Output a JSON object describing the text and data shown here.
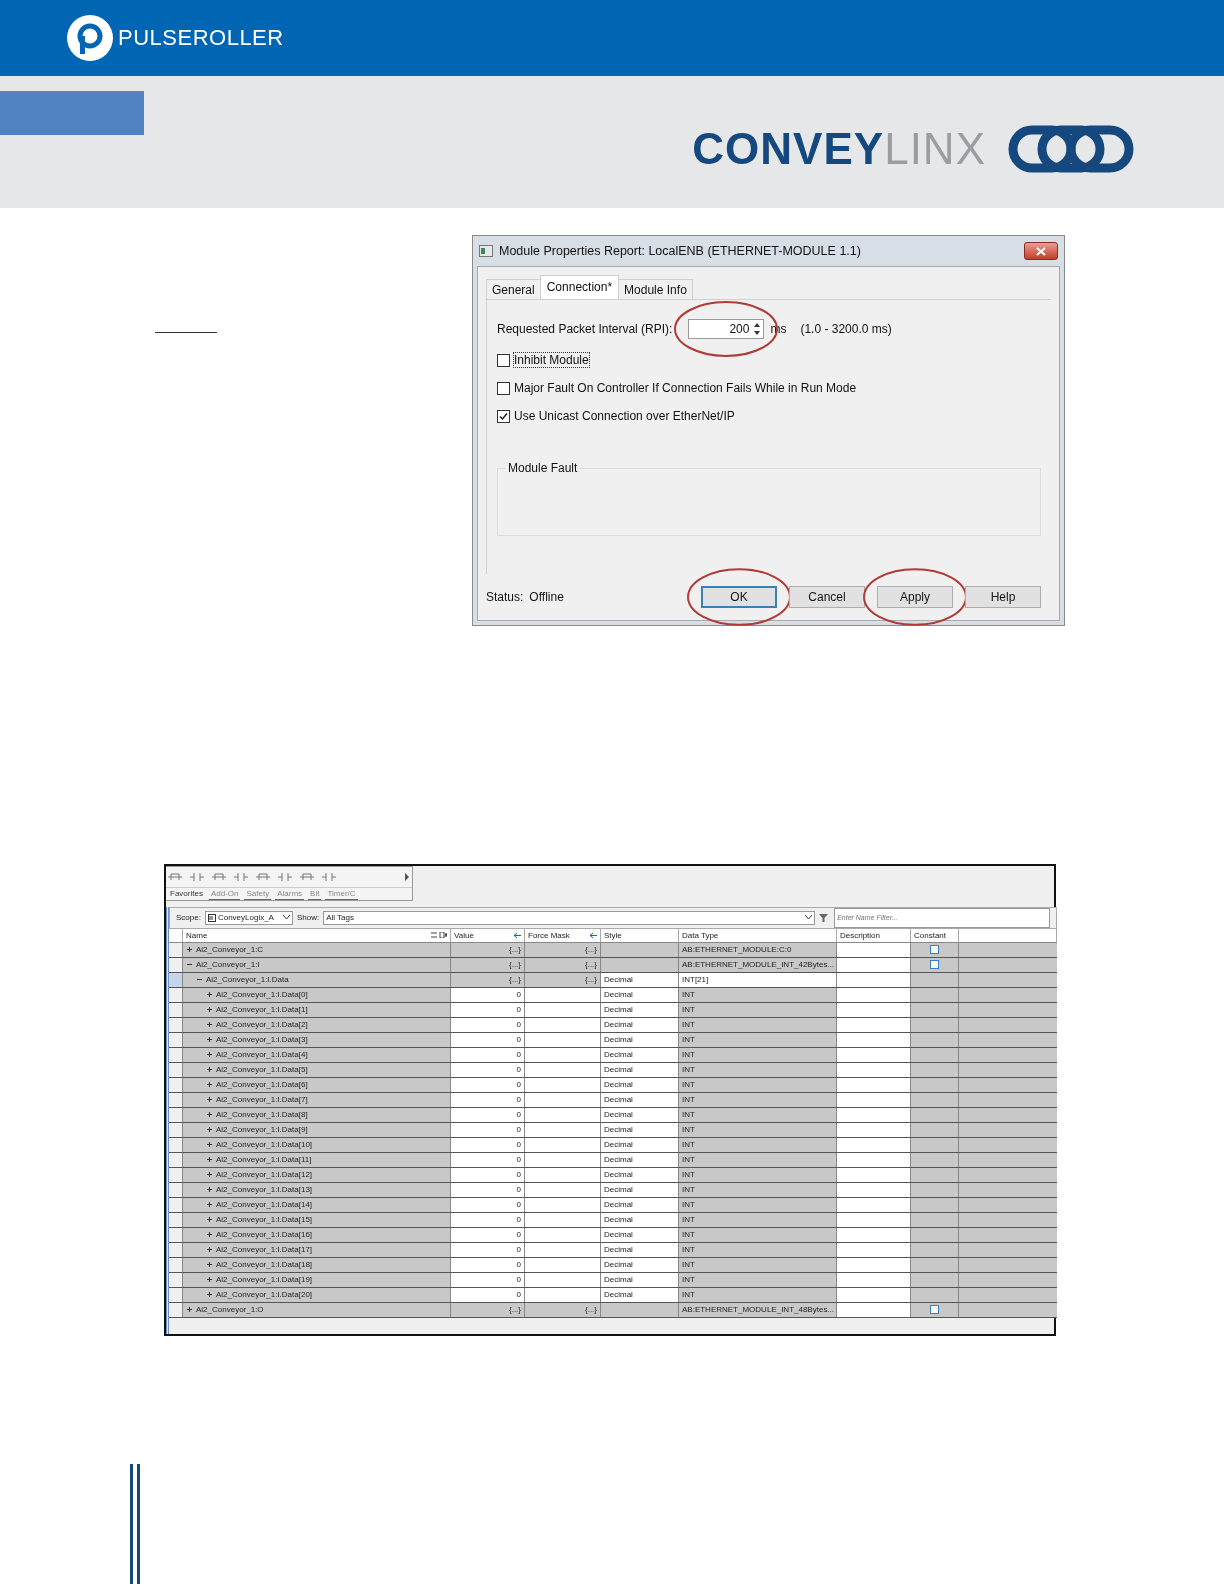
{
  "header": {
    "brand": "PULSEROLLER",
    "product_bold": "CONVEY",
    "product_light": "LINX"
  },
  "dialog": {
    "title": "Module Properties Report: LocalENB (ETHERNET-MODULE 1.1)",
    "tabs": [
      {
        "label": "General",
        "selected": false
      },
      {
        "label": "Connection*",
        "selected": true
      },
      {
        "label": "Module Info",
        "selected": false
      }
    ],
    "rpi": {
      "label": "Requested Packet Interval (RPI):",
      "value": "200",
      "unit": "ms",
      "range": "(1.0 - 3200.0 ms)",
      "circled": true
    },
    "options": [
      {
        "label": "Inhibit Module",
        "checked": false,
        "focused": true
      },
      {
        "label": "Major Fault On Controller If Connection Fails While in Run Mode",
        "checked": false,
        "focused": false
      },
      {
        "label": "Use Unicast Connection over EtherNet/IP",
        "checked": true,
        "focused": false
      }
    ],
    "group": {
      "title": "Module Fault"
    },
    "status": {
      "label": "Status:",
      "value": "Offline"
    },
    "buttons": [
      {
        "label": "OK",
        "default": true,
        "circled": true
      },
      {
        "label": "Cancel",
        "default": false,
        "circled": false
      },
      {
        "label": "Apply",
        "default": false,
        "circled": true
      },
      {
        "label": "Help",
        "default": false,
        "circled": false
      }
    ]
  },
  "tag_editor": {
    "palette_tabs": [
      {
        "label": "Favorites",
        "selected": true
      },
      {
        "label": "Add-On",
        "selected": false
      },
      {
        "label": "Safety",
        "selected": false
      },
      {
        "label": "Alarms",
        "selected": false
      },
      {
        "label": "Bit",
        "selected": false
      },
      {
        "label": "Timer/C",
        "selected": false
      }
    ],
    "scope": {
      "label": "Scope:",
      "value": "ConveyLogix_A"
    },
    "show": {
      "label": "Show:",
      "value": "All Tags"
    },
    "filter": {
      "placeholder": "Enter Name Filter..."
    },
    "columns": [
      "Name",
      "Value",
      "Force Mask",
      "Style",
      "Data Type",
      "Description",
      "Constant"
    ],
    "rows": [
      {
        "name": "Ai2_Conveyor_1:C",
        "kind": "structure",
        "expanded": false,
        "selected": false,
        "value": "{...}",
        "force_mask": "{...}",
        "data_type": "AB:ETHERNET_MODULE:C:0",
        "constant": false
      },
      {
        "name": "Ai2_Conveyor_1:I",
        "kind": "structure",
        "expanded": true,
        "selected": false,
        "value": "{...}",
        "force_mask": "{...}",
        "data_type": "AB:ETHERNET_MODULE_INT_42Bytes...",
        "constant": false,
        "children": [
          {
            "name": "Ai2_Conveyor_1:I.Data",
            "kind": "array",
            "expanded": true,
            "selected": true,
            "value": "{...}",
            "force_mask": "{...}",
            "style": "Decimal",
            "data_type": "INT[21]",
            "children": [
              {
                "name": "Ai2_Conveyor_1:I.Data[0]",
                "kind": "element",
                "expanded": false,
                "selected": false,
                "value": "0",
                "style": "Decimal",
                "data_type": "INT"
              },
              {
                "name": "Ai2_Conveyor_1:I.Data[1]",
                "kind": "element",
                "expanded": false,
                "selected": false,
                "value": "0",
                "style": "Decimal",
                "data_type": "INT"
              },
              {
                "name": "Ai2_Conveyor_1:I.Data[2]",
                "kind": "element",
                "expanded": false,
                "selected": false,
                "value": "0",
                "style": "Decimal",
                "data_type": "INT"
              },
              {
                "name": "Ai2_Conveyor_1:I.Data[3]",
                "kind": "element",
                "expanded": false,
                "selected": false,
                "value": "0",
                "style": "Decimal",
                "data_type": "INT"
              },
              {
                "name": "Ai2_Conveyor_1:I.Data[4]",
                "kind": "element",
                "expanded": false,
                "selected": false,
                "value": "0",
                "style": "Decimal",
                "data_type": "INT"
              },
              {
                "name": "Ai2_Conveyor_1:I.Data[5]",
                "kind": "element",
                "expanded": false,
                "selected": false,
                "value": "0",
                "style": "Decimal",
                "data_type": "INT"
              },
              {
                "name": "Ai2_Conveyor_1:I.Data[6]",
                "kind": "element",
                "expanded": false,
                "selected": false,
                "value": "0",
                "style": "Decimal",
                "data_type": "INT"
              },
              {
                "name": "Ai2_Conveyor_1:I.Data[7]",
                "kind": "element",
                "expanded": false,
                "selected": false,
                "value": "0",
                "style": "Decimal",
                "data_type": "INT"
              },
              {
                "name": "Ai2_Conveyor_1:I.Data[8]",
                "kind": "element",
                "expanded": false,
                "selected": false,
                "value": "0",
                "style": "Decimal",
                "data_type": "INT"
              },
              {
                "name": "Ai2_Conveyor_1:I.Data[9]",
                "kind": "element",
                "expanded": false,
                "selected": false,
                "value": "0",
                "style": "Decimal",
                "data_type": "INT"
              },
              {
                "name": "Ai2_Conveyor_1:I.Data[10]",
                "kind": "element",
                "expanded": false,
                "selected": false,
                "value": "0",
                "style": "Decimal",
                "data_type": "INT"
              },
              {
                "name": "Ai2_Conveyor_1:I.Data[11]",
                "kind": "element",
                "expanded": false,
                "selected": false,
                "value": "0",
                "style": "Decimal",
                "data_type": "INT"
              },
              {
                "name": "Ai2_Conveyor_1:I.Data[12]",
                "kind": "element",
                "expanded": false,
                "selected": false,
                "value": "0",
                "style": "Decimal",
                "data_type": "INT"
              },
              {
                "name": "Ai2_Conveyor_1:I.Data[13]",
                "kind": "element",
                "expanded": false,
                "selected": false,
                "value": "0",
                "style": "Decimal",
                "data_type": "INT"
              },
              {
                "name": "Ai2_Conveyor_1:I.Data[14]",
                "kind": "element",
                "expanded": false,
                "selected": false,
                "value": "0",
                "style": "Decimal",
                "data_type": "INT"
              },
              {
                "name": "Ai2_Conveyor_1:I.Data[15]",
                "kind": "element",
                "expanded": false,
                "selected": false,
                "value": "0",
                "style": "Decimal",
                "data_type": "INT"
              },
              {
                "name": "Ai2_Conveyor_1:I.Data[16]",
                "kind": "element",
                "expanded": false,
                "selected": false,
                "value": "0",
                "style": "Decimal",
                "data_type": "INT"
              },
              {
                "name": "Ai2_Conveyor_1:I.Data[17]",
                "kind": "element",
                "expanded": false,
                "selected": false,
                "value": "0",
                "style": "Decimal",
                "data_type": "INT"
              },
              {
                "name": "Ai2_Conveyor_1:I.Data[18]",
                "kind": "element",
                "expanded": false,
                "selected": false,
                "value": "0",
                "style": "Decimal",
                "data_type": "INT"
              },
              {
                "name": "Ai2_Conveyor_1:I.Data[19]",
                "kind": "element",
                "expanded": false,
                "selected": false,
                "value": "0",
                "style": "Decimal",
                "data_type": "INT"
              },
              {
                "name": "Ai2_Conveyor_1:I.Data[20]",
                "kind": "element",
                "expanded": false,
                "selected": false,
                "value": "0",
                "style": "Decimal",
                "data_type": "INT"
              }
            ]
          }
        ]
      },
      {
        "name": "Ai2_Conveyor_1:O",
        "kind": "structure",
        "expanded": false,
        "selected": false,
        "value": "{...}",
        "force_mask": "{...}",
        "data_type": "AB:ETHERNET_MODULE_INT_48Bytes...",
        "constant": false
      }
    ]
  }
}
